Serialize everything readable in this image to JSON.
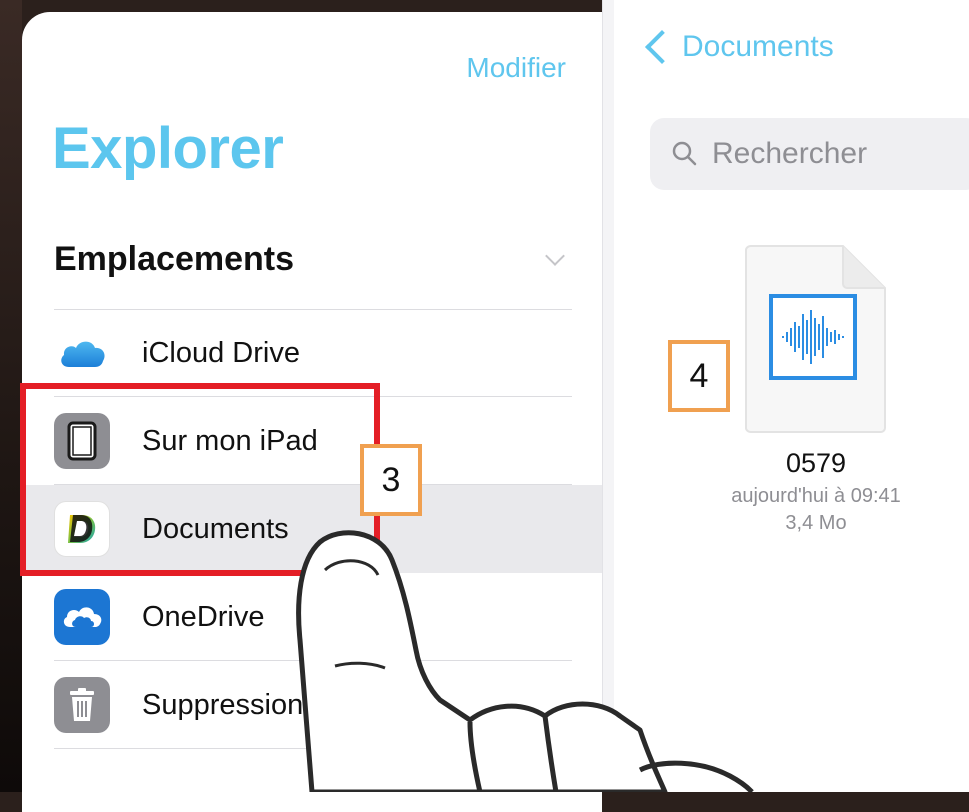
{
  "sidebar": {
    "edit_label": "Modifier",
    "title": "Explorer",
    "section_title": "Emplacements",
    "items": [
      {
        "label": "iCloud Drive",
        "icon": "icloud-icon"
      },
      {
        "label": "Sur mon iPad",
        "icon": "ipad-icon"
      },
      {
        "label": "Documents",
        "icon": "documents-app-icon",
        "selected": true
      },
      {
        "label": "OneDrive",
        "icon": "onedrive-icon"
      },
      {
        "label": "Suppressions récentes",
        "icon": "trash-icon"
      }
    ]
  },
  "annotations": {
    "step3": "3",
    "step4": "4"
  },
  "main": {
    "back_label": "Documents",
    "search_placeholder": "Rechercher",
    "file": {
      "name": "0579",
      "date": "aujourd'hui à 09:41",
      "size": "3,4 Mo",
      "icon": "audio-waveform-file-icon"
    }
  },
  "colors": {
    "accent": "#5fc6ee",
    "highlight": "#e41e26",
    "callout": "#f0a050"
  }
}
